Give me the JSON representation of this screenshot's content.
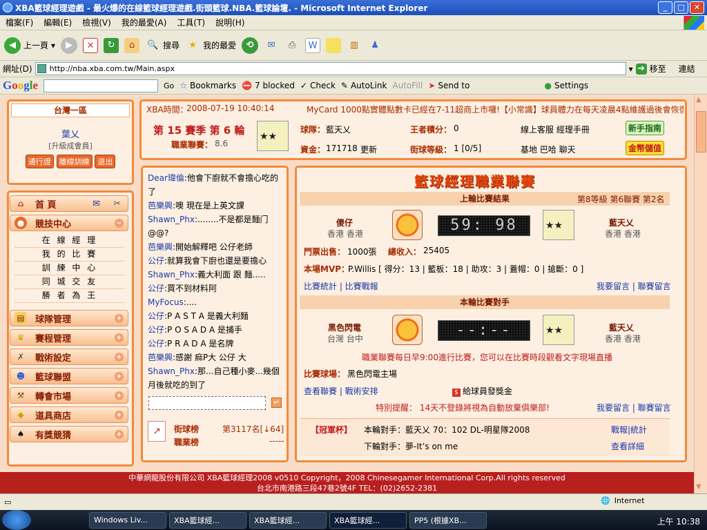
{
  "window": {
    "title": "XBA籃球經理遊戲 - 最火爆的在線籃球經理遊戲.街頭籃球.NBA.籃球論壇. - Microsoft Internet Explorer",
    "buttons": [
      "_",
      "□",
      "✕"
    ]
  },
  "menubar": [
    "檔案(F)",
    "編輯(E)",
    "檢視(V)",
    "我的最愛(A)",
    "工具(T)",
    "說明(H)"
  ],
  "toolbar": {
    "back": "上一頁",
    "search": "搜尋",
    "favorites": "我的最愛"
  },
  "address": {
    "label": "網址(D)",
    "url": "http://nba.xba.com.tw/Main.aspx",
    "go": "移至",
    "links": "連結"
  },
  "googlebar": {
    "logo": "Google",
    "go": "Go",
    "bookmarks": "Bookmarks",
    "blocked": "7 blocked",
    "check": "Check",
    "autolink": "AutoLink",
    "autofill": "AutoFill",
    "sendto": "Send to",
    "settings": "Settings"
  },
  "left": {
    "region": "台灣一區",
    "user": "葉乂",
    "rank": "[升級成會員]",
    "buttons": [
      "通行證",
      "離線訓練",
      "退出"
    ],
    "home": "首 頁",
    "competition": "競技中心",
    "submenu": [
      "在 線 經 理",
      "我 的 比 賽",
      "訓 練 中 心",
      "同 城 交 友",
      "勝 者 為 王"
    ],
    "menus": [
      "球隊管理",
      "賽程管理",
      "戰術設定",
      "籃球聯盟",
      "轉會市場",
      "道具商店",
      "有獎競猜"
    ]
  },
  "topinfo": {
    "time_label": "XBA時間：",
    "time": "2008-07-19 10:40:14",
    "marquee": "MyCard 1000點實體點數卡已經在7-11超商上市囉!【小常識】球員體力在每天凌晨4點維護過後會恢復",
    "season": "第 15 賽季 第 6 輪",
    "league_label": "職業聯賽：",
    "league_value": "8.6",
    "team_label": "球隊：",
    "team": "藍天乂",
    "kingpts_label": "王者積分：",
    "kingpts": "0",
    "cs": "線上客服  經理手冊",
    "guide": "新手指南",
    "funds_label": "資金：",
    "funds": "171718",
    "update": "更新",
    "streetlvl_label": "街球等級：",
    "streetlvl": "1 [0/5]",
    "base": "基地  巴哈  聊天",
    "gold": "金幣儲值"
  },
  "chat": [
    {
      "n": "Dear瑋倫",
      "t": ":他會下廚就不會擔心吃的了"
    },
    {
      "n": "芭樂興",
      "t": ":噢  現在是上英文課"
    },
    {
      "n": "Shawn_Phx",
      "t": ":........不是都是麵门 @@?"
    },
    {
      "n": "芭樂興",
      "t": ":開始解釋吧  公仔老師"
    },
    {
      "n": "公仔",
      "t": ":就算我會下廚也還是要擔心"
    },
    {
      "n": "Shawn_Phx",
      "t": ":義大利面  跟  麵....."
    },
    {
      "n": "公仔",
      "t": ":買不到材料阿"
    },
    {
      "n": "MyFocus",
      "t": ":...."
    },
    {
      "n": "公仔",
      "t": ":P A S T A 是義大利麵"
    },
    {
      "n": "公仔",
      "t": ":P O S A D A 是捕手"
    },
    {
      "n": "公仔",
      "t": ":P R A D A 是名牌"
    },
    {
      "n": "芭樂興",
      "t": ":感謝  痲P大  公仔  大"
    },
    {
      "n": "Shawn_Phx",
      "t": ":那...自己種小麥...幾個月後就吃的到了"
    }
  ],
  "rank": {
    "street": "街球榜",
    "street_val": "第3117名[↓64]",
    "league": "職業榜",
    "league_val": "-----"
  },
  "main": {
    "title": "籃球經理職業聯賽",
    "last_hdr": "上輪比賽結果",
    "last_meta": "第8等級  第6聯賽  第2名",
    "home_team": "傻仔",
    "home_loc": "香港  香港",
    "score": "59: 98",
    "away_team": "藍天乂",
    "away_loc": "香港  香港",
    "tickets_label": "門票出售：",
    "tickets": "1000張",
    "income_label": "總收入：",
    "income": "25405",
    "mvp_label": "本場MVP：",
    "mvp": "P.Willis  [ 得分：13 | 籃板：18 | 助攻：3 | 蓋帽：0 | 搶斷：0 ]",
    "links1": "比賽統計 | 比賽戰報",
    "msg1": "我要留言 | 聯賽留言",
    "next_hdr": "本輪比賽對手",
    "next_home": "黑色閃電",
    "next_home_loc": "台灣  台中",
    "next_score": "--:--",
    "next_away": "藍天乂",
    "next_away_loc": "香港  香港",
    "notice": "職業聯賽每日早9:00進行比賽，您可以在比賽時段觀看文字現場直播",
    "court_label": "比賽球場：",
    "court": "黑色閃電主場",
    "links2": "查看聯賽 | 戰術安排",
    "bonus": "給球員發獎金",
    "warn": "特別提醒：  14天不登錄將視為自動放棄俱樂部!",
    "msg2": "我要留言 | 聯賽留言",
    "cup_label": "【冠軍杯】",
    "cup_this": "本輪對手：藍天乂  70：102 DL-明星隊2008",
    "cup_next": "下輪對手：夢-It’s on me",
    "cup_links": "戰報|統計",
    "cup_detail": "查看詳細"
  },
  "footer": {
    "line1": "中華網龍股份有限公司  XBA籃球經理2008 v0510      Copyright，2008 Chinesegamer International Corp.All rights reserved",
    "line2": "台北市南港路三段47巷2號4F TEL：(02)2652-2381"
  },
  "status": {
    "zone": "Internet"
  },
  "taskbar": {
    "tasks": [
      "Windows Liv...",
      "XBA籃球經...",
      "XBA籃球經...",
      "XBA籃球經...",
      "PP5 (根據XB..."
    ],
    "clock": "上午 10:38"
  }
}
